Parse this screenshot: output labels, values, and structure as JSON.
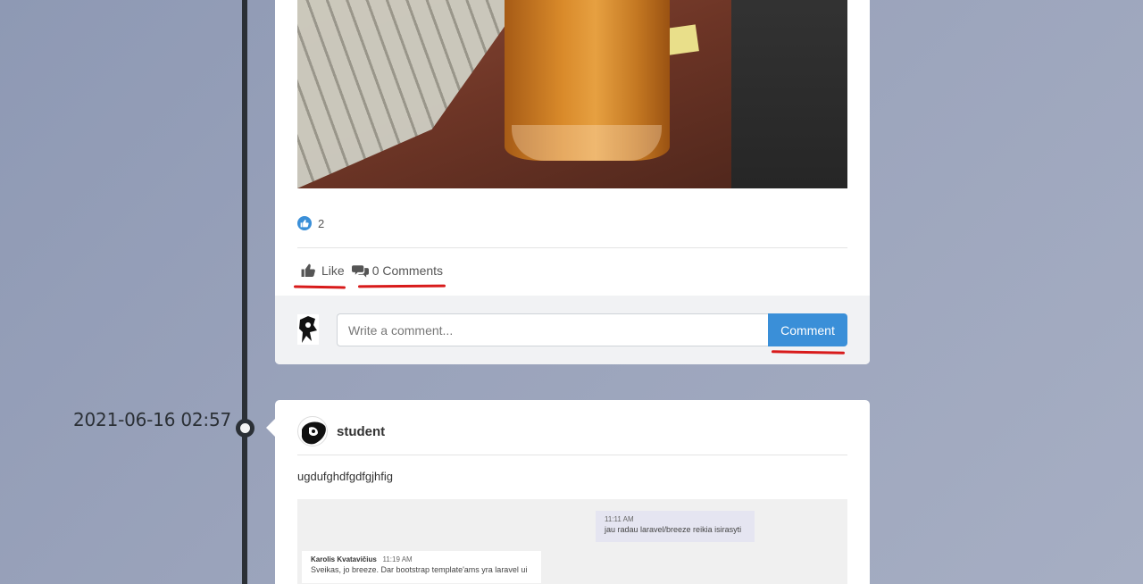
{
  "timeline": {
    "date_label": "2021-06-16 02:57"
  },
  "post1": {
    "like_count": "2",
    "like_label": "Like",
    "comments_label": "0 Comments",
    "comment_placeholder": "Write a comment...",
    "comment_button": "Comment"
  },
  "post2": {
    "author": "student",
    "text": "ugdufghdfgdfgjhfig",
    "screenshot": {
      "msg1_time": "11:11 AM",
      "msg1_text": "jau radau laravel/breeze reikia isirasyti",
      "msg2_name": "Karolis Kvatavičius",
      "msg2_time": "11:19 AM",
      "msg2_text": "Sveikas, jo breeze. Dar bootstrap template'ams yra laravel ui"
    }
  },
  "colors": {
    "accent": "#3a8fd8",
    "annotation": "#d81b1b",
    "timeline": "#2b3036"
  }
}
